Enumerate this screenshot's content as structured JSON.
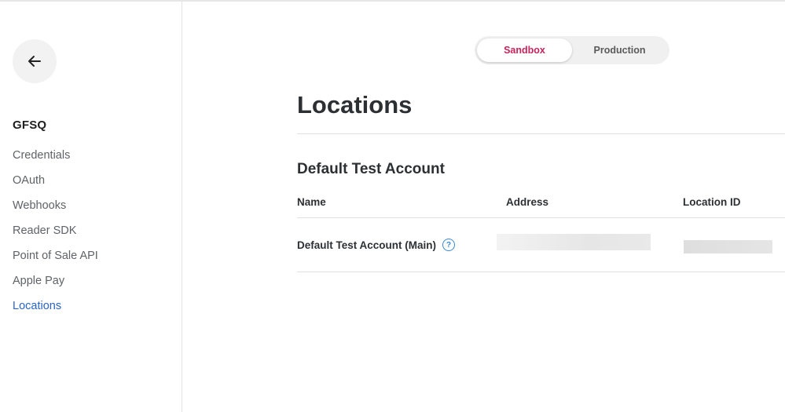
{
  "sidebar": {
    "app_name": "GFSQ",
    "back_icon": "arrow-left-icon",
    "items": [
      {
        "label": "Credentials",
        "active": false
      },
      {
        "label": "OAuth",
        "active": false
      },
      {
        "label": "Webhooks",
        "active": false
      },
      {
        "label": "Reader SDK",
        "active": false
      },
      {
        "label": "Point of Sale API",
        "active": false
      },
      {
        "label": "Apple Pay",
        "active": false
      },
      {
        "label": "Locations",
        "active": true
      }
    ]
  },
  "environment": {
    "options": [
      "Sandbox",
      "Production"
    ],
    "selected": "Sandbox"
  },
  "main": {
    "title": "Locations",
    "section_title": "Default Test Account",
    "table": {
      "columns": [
        "Name",
        "Address",
        "Location ID"
      ],
      "rows": [
        {
          "name": "Default Test Account (Main)",
          "help_icon": "question-circle-icon",
          "address": "",
          "location_id": ""
        }
      ]
    }
  },
  "colors": {
    "active_link": "#2a64c4",
    "toggle_selected": "#c6245a",
    "help_icon": "#3a86d6"
  }
}
